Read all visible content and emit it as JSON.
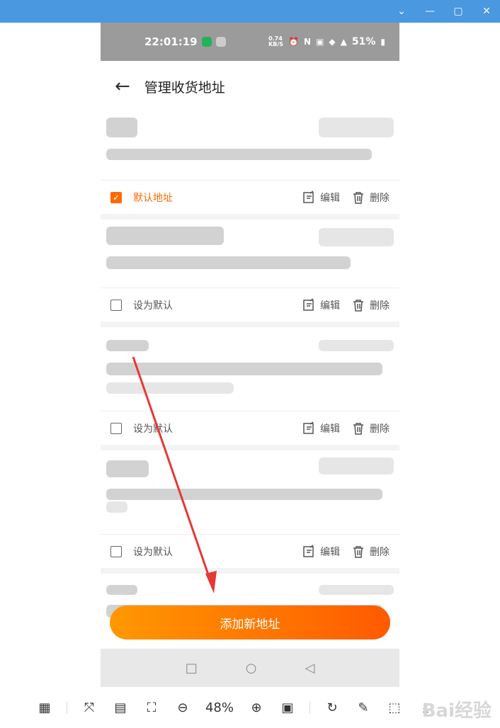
{
  "statusbar": {
    "time": "22:01:19",
    "speed": "0.74\nKB/S",
    "battery": "51%"
  },
  "page": {
    "title": "管理收货地址"
  },
  "addresses": [
    {
      "default": true,
      "label": "默认地址"
    },
    {
      "default": false,
      "label": "设为默认"
    },
    {
      "default": false,
      "label": "设为默认"
    },
    {
      "default": false,
      "label": "设为默认"
    }
  ],
  "actions": {
    "edit": "编辑",
    "delete": "删除"
  },
  "add_button": "添加新地址",
  "toolbar": {
    "zoom": "48%"
  },
  "colors": {
    "accent": "#ff6a00",
    "titlebar": "#4a98e0"
  }
}
